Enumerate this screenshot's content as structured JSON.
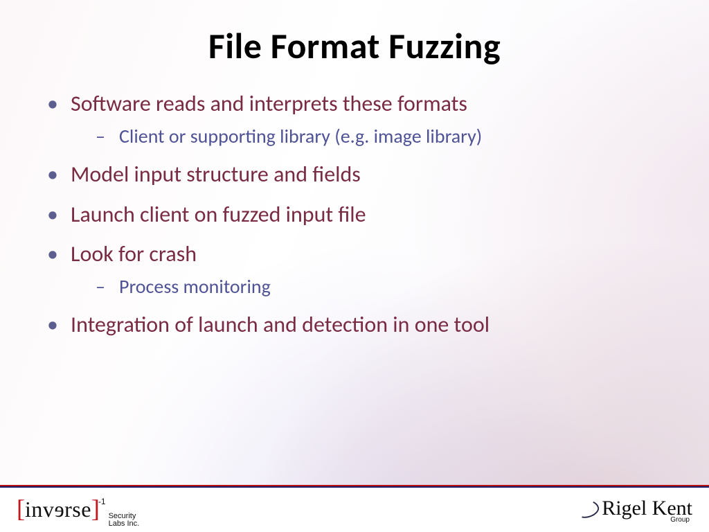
{
  "title": "File Format Fuzzing",
  "bullets": {
    "b1": "Software reads and interprets these formats",
    "b1_sub1": "Client or supporting library (e.g. image library)",
    "b2": "Model input structure and fields",
    "b3": "Launch client on fuzzed input file",
    "b4": "Look for crash",
    "b4_sub1": "Process monitoring",
    "b5": "Integration of launch and detection in one tool"
  },
  "footer": {
    "left_word": "inv",
    "left_word_flip": "e",
    "left_word_tail": "rse",
    "left_exp": "-1",
    "left_sub1": "Security",
    "left_sub2": "Labs Inc.",
    "right_main": "Rigel Kent",
    "right_sub": "Group"
  }
}
